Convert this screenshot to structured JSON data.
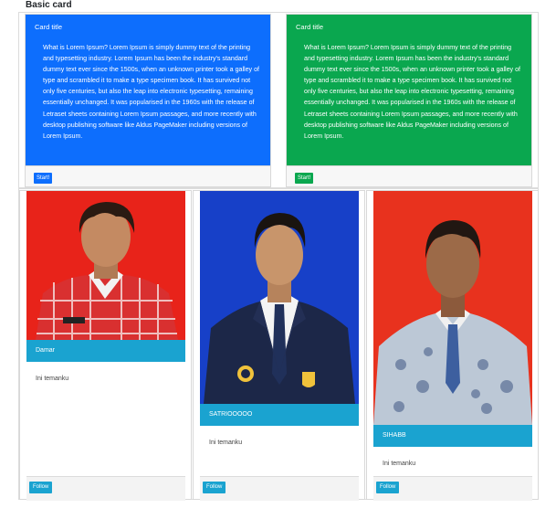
{
  "page": {
    "heading": "Basic card"
  },
  "text_cards": [
    {
      "title": "Card title",
      "body": "What is Lorem Ipsum? Lorem Ipsum is simply dummy text of the printing and typesetting industry. Lorem Ipsum has been the industry's standard dummy text ever since the 1500s, when an unknown printer took a galley of type and scrambled it to make a type specimen book. It has survived not only five centuries, but also the leap into electronic typesetting, remaining essentially unchanged. It was popularised in the 1960s with the release of Letraset sheets containing Lorem Ipsum passages, and more recently with desktop publishing software like Aldus PageMaker including versions of Lorem Ipsum.",
      "button": "Start!",
      "color": "#0d6efd"
    },
    {
      "title": "Card title",
      "body": "What is Lorem Ipsum? Lorem Ipsum is simply dummy text of the printing and typesetting industry. Lorem Ipsum has been the industry's standard dummy text ever since the 1500s, when an unknown printer took a galley of type and scrambled it to make a type specimen book. It has survived not only five centuries, but also the leap into electronic typesetting, remaining essentially unchanged. It was popularised in the 1960s with the release of Letraset sheets containing Lorem Ipsum passages, and more recently with desktop publishing software like Aldus PageMaker including versions of Lorem Ipsum.",
      "button": "Start!",
      "color": "#0aa74f"
    }
  ],
  "photo_cards": [
    {
      "name": "Damar",
      "text": "Ini temanku",
      "button": "Follow",
      "background": "#e8231a"
    },
    {
      "name": "SATRIOOOOO",
      "text": "Ini temanku",
      "button": "Follow",
      "background": "#1740c8"
    },
    {
      "name": "SIHABB",
      "text": "Ini temanku",
      "button": "Follow",
      "background": "#e8321e"
    }
  ],
  "colors": {
    "blue": "#0d6efd",
    "green": "#0aa74f",
    "info": "#1aa3d0"
  }
}
